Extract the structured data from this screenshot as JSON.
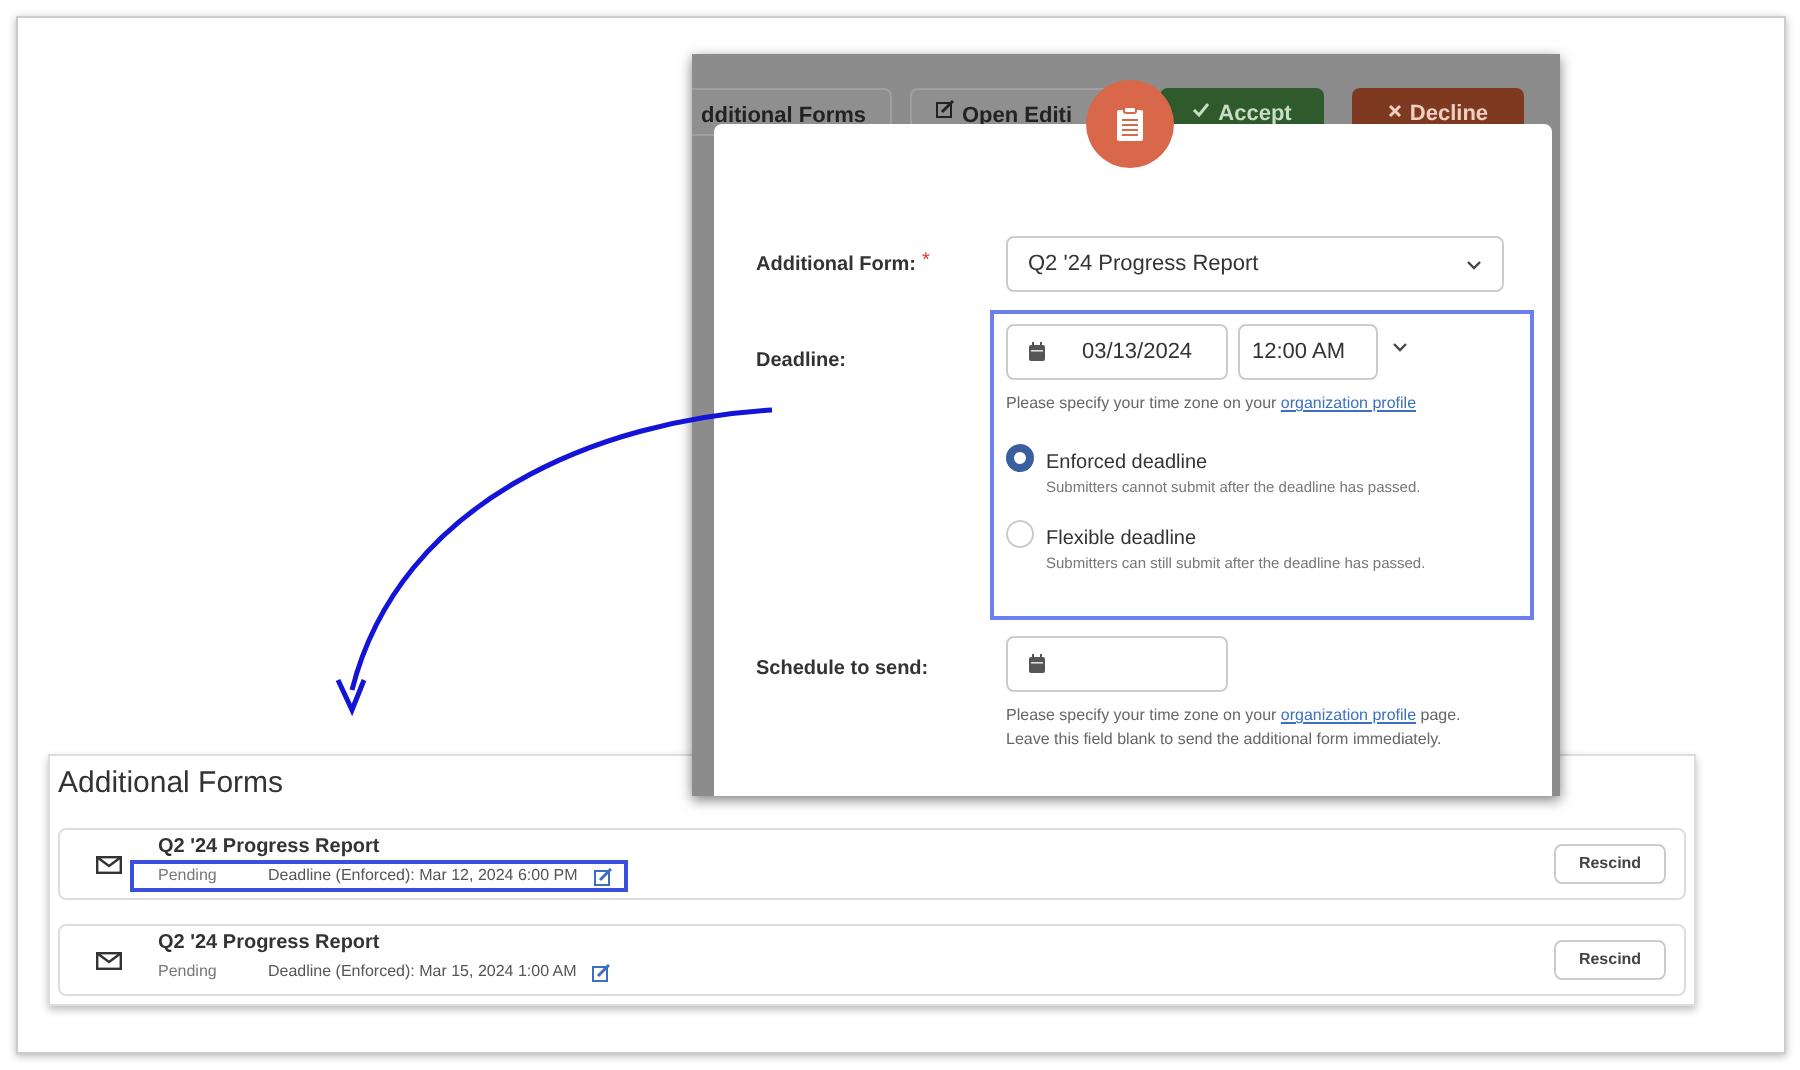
{
  "background_toolbar": {
    "buttons": [
      {
        "label": "dditional Forms",
        "kind": "plain"
      },
      {
        "label": "Open Editi",
        "kind": "edit"
      },
      {
        "label": "Accept",
        "kind": "accept"
      },
      {
        "label": "Decline",
        "kind": "decline"
      }
    ]
  },
  "modal": {
    "additional_form": {
      "label": "Additional Form:",
      "required_mark": "*",
      "value": "Q2 '24 Progress Report"
    },
    "deadline": {
      "label": "Deadline:",
      "date": "03/13/2024",
      "time": "12:00 AM",
      "hint": "Please specify your time zone on your",
      "hint_link": "organization profile",
      "highlighted": true,
      "options": [
        {
          "label": "Enforced deadline",
          "description": "Submitters cannot submit after the deadline has passed.",
          "selected": true
        },
        {
          "label": "Flexible deadline",
          "description": "Submitters can still submit after the deadline has passed.",
          "selected": false
        }
      ]
    },
    "schedule": {
      "label": "Schedule to send:",
      "hint": "Please specify your time zone on your",
      "hint_link": "organization profile",
      "hint_end": "page. Leave this field blank to send the additional form immediately."
    }
  },
  "additional_forms": {
    "title": "Additional Forms",
    "items": [
      {
        "title": "Q2 '24 Progress Report",
        "status": "Pending",
        "deadline": "Deadline (Enforced): Mar 12, 2024 6:00 PM",
        "action": "Rescind",
        "highlighted": true
      },
      {
        "title": "Q2 '24 Progress Report",
        "status": "Pending",
        "deadline": "Deadline (Enforced): Mar 15, 2024 1:00 AM",
        "action": "Rescind",
        "highlighted": false
      }
    ]
  }
}
